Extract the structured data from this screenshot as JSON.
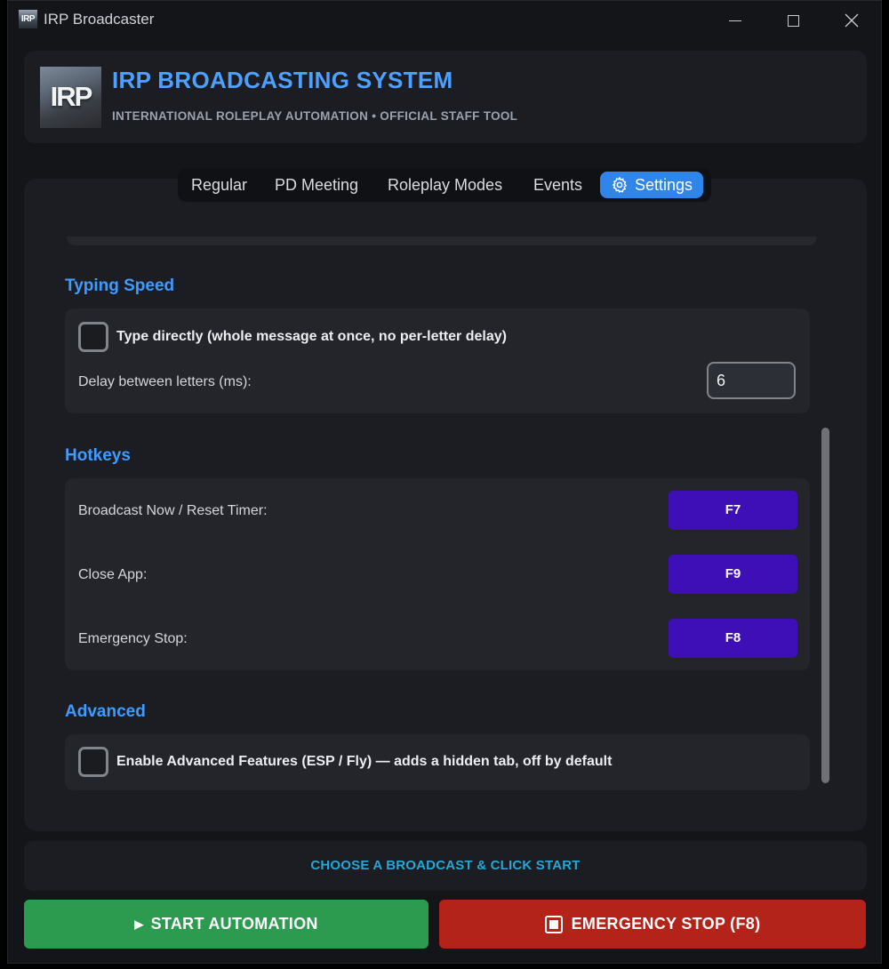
{
  "window": {
    "title": "IRP Broadcaster",
    "icon_label": "IRP"
  },
  "header": {
    "logo_text": "IRP",
    "title": "IRP BROADCASTING SYSTEM",
    "subtitle": "INTERNATIONAL ROLEPLAY AUTOMATION • OFFICIAL STAFF TOOL"
  },
  "tabs": [
    {
      "label": "Regular",
      "active": false
    },
    {
      "label": "PD Meeting",
      "active": false
    },
    {
      "label": "Roleplay Modes",
      "active": false
    },
    {
      "label": "Events",
      "active": false
    },
    {
      "label": "Settings",
      "active": true,
      "icon": "gear-icon"
    }
  ],
  "typing_speed": {
    "title": "Typing Speed",
    "direct_checkbox_label": "Type directly (whole message at once, no per-letter delay)",
    "direct_checked": false,
    "delay_label": "Delay between letters (ms):",
    "delay_value": "6"
  },
  "hotkeys": {
    "title": "Hotkeys",
    "items": [
      {
        "label": "Broadcast Now / Reset Timer:",
        "key": "F7"
      },
      {
        "label": "Close App:",
        "key": "F9"
      },
      {
        "label": "Emergency Stop:",
        "key": "F8"
      }
    ]
  },
  "advanced": {
    "title": "Advanced",
    "checkbox_label": "Enable Advanced Features (ESP / Fly) — adds a hidden tab, off by default",
    "checked": false
  },
  "status": {
    "text": "CHOOSE A BROADCAST & CLICK START"
  },
  "actions": {
    "start_label": "START AUTOMATION",
    "stop_label": "EMERGENCY STOP (F8)"
  },
  "colors": {
    "accent": "#3f9bff",
    "tab_active": "#2f86e8",
    "hotkey": "#3e0fb6",
    "start": "#2c9b4f",
    "stop": "#b4231a",
    "status_text": "#28a6d6"
  }
}
